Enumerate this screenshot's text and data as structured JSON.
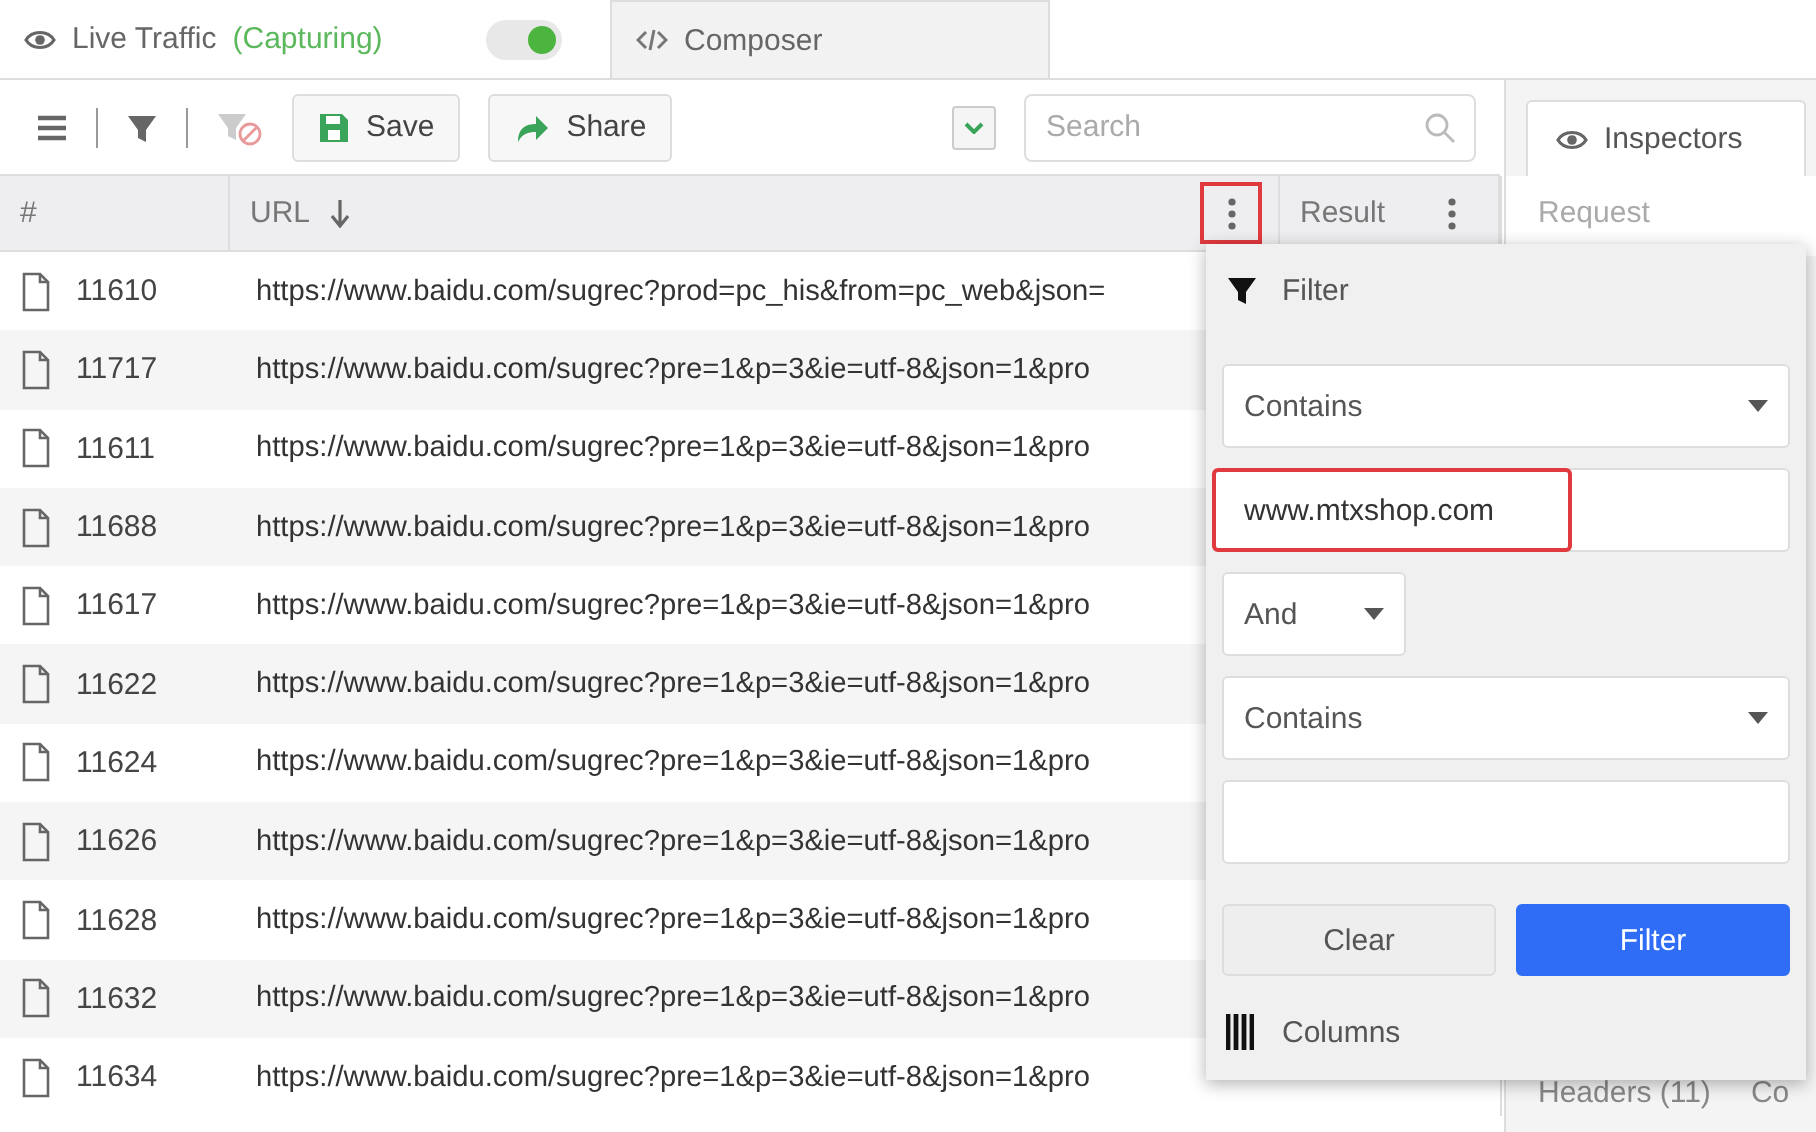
{
  "tabs": [
    {
      "kind": "traffic",
      "label": "Live Traffic",
      "status": "(Capturing)",
      "capturing": true,
      "selected": true
    },
    {
      "kind": "composer",
      "label": "Composer",
      "selected": false
    }
  ],
  "toolbar": {
    "buttons": [
      {
        "kind": "save",
        "label": "Save"
      },
      {
        "kind": "share",
        "label": "Share"
      }
    ],
    "search": {
      "placeholder": "Search"
    }
  },
  "grid": {
    "columns": [
      {
        "label": "#"
      },
      {
        "label": "URL",
        "sorted": true,
        "menu_highlighted": true
      },
      {
        "label": "Result",
        "menu_highlighted": false
      }
    ],
    "rows": [
      {
        "id": "11610",
        "url": "https://www.baidu.com/sugrec?prod=pc_his&from=pc_web&json="
      },
      {
        "id": "11717",
        "url": "https://www.baidu.com/sugrec?pre=1&p=3&ie=utf-8&json=1&pro"
      },
      {
        "id": "11611",
        "url": "https://www.baidu.com/sugrec?pre=1&p=3&ie=utf-8&json=1&pro"
      },
      {
        "id": "11688",
        "url": "https://www.baidu.com/sugrec?pre=1&p=3&ie=utf-8&json=1&pro"
      },
      {
        "id": "11617",
        "url": "https://www.baidu.com/sugrec?pre=1&p=3&ie=utf-8&json=1&pro"
      },
      {
        "id": "11622",
        "url": "https://www.baidu.com/sugrec?pre=1&p=3&ie=utf-8&json=1&pro"
      },
      {
        "id": "11624",
        "url": "https://www.baidu.com/sugrec?pre=1&p=3&ie=utf-8&json=1&pro"
      },
      {
        "id": "11626",
        "url": "https://www.baidu.com/sugrec?pre=1&p=3&ie=utf-8&json=1&pro"
      },
      {
        "id": "11628",
        "url": "https://www.baidu.com/sugrec?pre=1&p=3&ie=utf-8&json=1&pro"
      },
      {
        "id": "11632",
        "url": "https://www.baidu.com/sugrec?pre=1&p=3&ie=utf-8&json=1&pro"
      },
      {
        "id": "11634",
        "url": "https://www.baidu.com/sugrec?pre=1&p=3&ie=utf-8&json=1&pro"
      }
    ]
  },
  "filter_popup": {
    "title": "Filter",
    "condition_1": "Contains",
    "value_1": "www.mtxshop.com",
    "value_1_highlighted": true,
    "join": "And",
    "condition_2": "Contains",
    "buttons": [
      {
        "kind": "clear",
        "label": "Clear"
      },
      {
        "kind": "apply",
        "label": "Filter"
      }
    ],
    "columns_label": "Columns"
  },
  "inspector": {
    "tab": "Inspectors",
    "section": "Request",
    "bottom_tabs": [
      "Headers (11)",
      "Co"
    ]
  }
}
